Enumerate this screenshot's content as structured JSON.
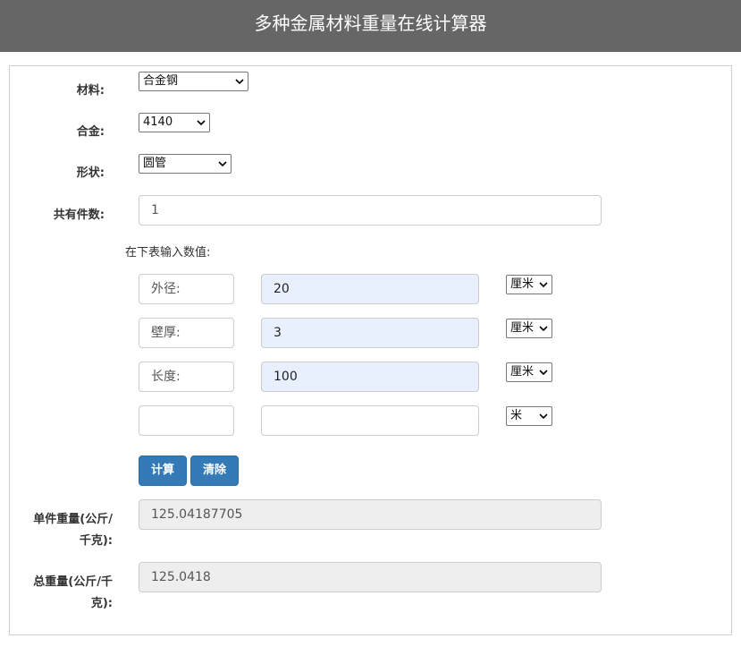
{
  "header": {
    "title": "多种金属材料重量在线计算器"
  },
  "form": {
    "material": {
      "label": "材料:",
      "value": "合金钢"
    },
    "alloy": {
      "label": "合金:",
      "value": "4140"
    },
    "shape": {
      "label": "形状:",
      "value": "圆管"
    },
    "count": {
      "label": "共有件数:",
      "value": "1"
    },
    "instruction": "在下表输入数值:",
    "rows": [
      {
        "name": "外径:",
        "value": "20",
        "unit": "厘米"
      },
      {
        "name": "壁厚:",
        "value": "3",
        "unit": "厘米"
      },
      {
        "name": "长度:",
        "value": "100",
        "unit": "厘米"
      },
      {
        "name": "",
        "value": "",
        "unit": "米"
      }
    ],
    "buttons": {
      "calculate": "计算",
      "clear": "清除"
    },
    "unit_weight": {
      "label_line1": "单件重量(公斤/",
      "label_line2": "千克):",
      "value": "125.04187705"
    },
    "total_weight": {
      "label_line1": "总重量(公斤/千",
      "label_line2": "克):",
      "value": "125.0418"
    }
  },
  "icons": {
    "select_arrow": "chevron-down-icon"
  }
}
